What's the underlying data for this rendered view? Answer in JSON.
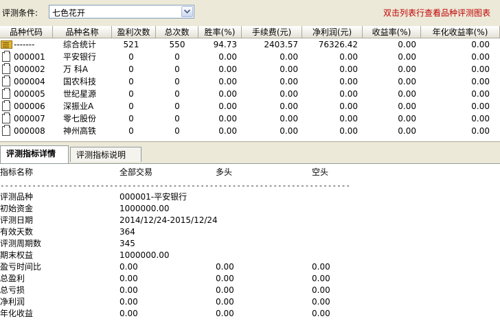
{
  "condition": {
    "label": "评测条件:",
    "value": "七色花开"
  },
  "hint": "双击列表行查看品种评测图表",
  "columns": [
    "品种代码",
    "品种名称",
    "盈利次数",
    "总次数",
    "胜率(%)",
    "手续费(元)",
    "净利润(元)",
    "收益率(%)",
    "年化收益率(%)"
  ],
  "rows": [
    {
      "code": "-------",
      "name": "综合统计",
      "wins": "521",
      "total": "550",
      "rate": "94.73",
      "fee": "2403.57",
      "profit": "76326.42",
      "ret": "0.00",
      "annual": "0.00",
      "icon": "summary-icon"
    },
    {
      "code": "000001",
      "name": "平安银行",
      "wins": "0",
      "total": "0",
      "rate": "0.00",
      "fee": "0.00",
      "profit": "0.00",
      "ret": "0.00",
      "annual": "0.00",
      "icon": "document-icon"
    },
    {
      "code": "000002",
      "name": "万  科A",
      "wins": "0",
      "total": "0",
      "rate": "0.00",
      "fee": "0.00",
      "profit": "0.00",
      "ret": "0.00",
      "annual": "0.00",
      "icon": "document-icon"
    },
    {
      "code": "000004",
      "name": "国农科技",
      "wins": "0",
      "total": "0",
      "rate": "0.00",
      "fee": "0.00",
      "profit": "0.00",
      "ret": "0.00",
      "annual": "0.00",
      "icon": "document-icon"
    },
    {
      "code": "000005",
      "name": "世纪星源",
      "wins": "0",
      "total": "0",
      "rate": "0.00",
      "fee": "0.00",
      "profit": "0.00",
      "ret": "0.00",
      "annual": "0.00",
      "icon": "document-icon"
    },
    {
      "code": "000006",
      "name": "深振业A",
      "wins": "0",
      "total": "0",
      "rate": "0.00",
      "fee": "0.00",
      "profit": "0.00",
      "ret": "0.00",
      "annual": "0.00",
      "icon": "document-icon"
    },
    {
      "code": "000007",
      "name": "零七股份",
      "wins": "0",
      "total": "0",
      "rate": "0.00",
      "fee": "0.00",
      "profit": "0.00",
      "ret": "0.00",
      "annual": "0.00",
      "icon": "document-icon"
    },
    {
      "code": "000008",
      "name": "神州高铁",
      "wins": "0",
      "total": "0",
      "rate": "0.00",
      "fee": "0.00",
      "profit": "0.00",
      "ret": "0.00",
      "annual": "0.00",
      "icon": "document-icon"
    }
  ],
  "tabs": [
    "评测指标详情",
    "评测指标说明"
  ],
  "detail": {
    "headers": [
      "指标名称",
      "全部交易",
      "多头",
      "空头"
    ],
    "separator": "-------------------------------------------------------------------------------",
    "items": [
      {
        "name": "评测品种",
        "all": "000001-平安银行",
        "long": "",
        "short": ""
      },
      {
        "name": "初始资金",
        "all": "1000000.00",
        "long": "",
        "short": ""
      },
      {
        "name": "评测日期",
        "all": "2014/12/24-2015/12/24",
        "long": "",
        "short": ""
      },
      {
        "name": "有效天数",
        "all": "364",
        "long": "",
        "short": ""
      },
      {
        "name": "评测周期数",
        "all": "345",
        "long": "",
        "short": ""
      },
      {
        "name": "期末权益",
        "all": "1000000.00",
        "long": "",
        "short": ""
      },
      {
        "name": "盈亏时间比",
        "all": "0.00",
        "long": "0.00",
        "short": "0.00"
      },
      {
        "name": "总盈利",
        "all": "0.00",
        "long": "0.00",
        "short": "0.00"
      },
      {
        "name": "总亏损",
        "all": "0.00",
        "long": "0.00",
        "short": "0.00"
      },
      {
        "name": "净利润",
        "all": "0.00",
        "long": "0.00",
        "short": "0.00"
      },
      {
        "name": "年化收益",
        "all": "0.00",
        "long": "0.00",
        "short": "0.00"
      }
    ]
  },
  "colors": {
    "hint": "#c00000",
    "face": "#ece9d8",
    "summary_icon": "#e2b433"
  }
}
